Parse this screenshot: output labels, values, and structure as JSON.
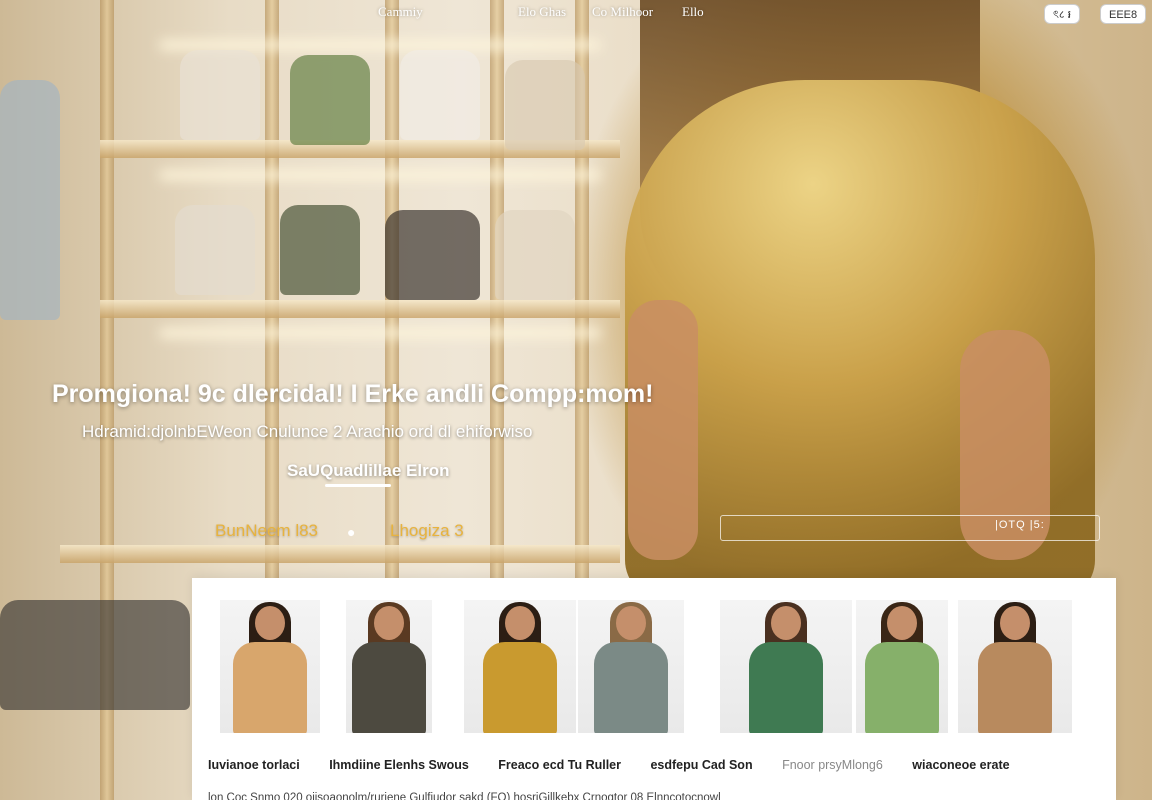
{
  "nav": {
    "links": [
      "Cammiy",
      "Elo Ghas",
      "Co Milhoor",
      "Ello"
    ],
    "button_1": "ৎ८ ៛",
    "button_2": "ЕЕЕ8"
  },
  "hero": {
    "title": "Promgiona! 9c dlercidal! I Erke andli Compp:mom!",
    "subtitle": "Hdramid:djolnbEWeon Cnulunce 2 Arachio ord dl ehiforwiso",
    "cta": "SaUQuadlillae Elron",
    "meta_left": "BunNeem l83",
    "meta_right": "Lhogiza 3",
    "waist_label": "|OTQ |5:"
  },
  "products": {
    "labels": [
      "Iuvianoe torlaci",
      "Ihmdiine Elenhs Swous",
      "Freaco ecd Tu Ruller",
      "esdfepu Cad Son",
      "Fnoor prsyMlong6",
      "wiaconeoe erate"
    ],
    "description": "lon Coc Snmo 020 oiisoaonolm/ruriene Gulfiudor sakd (FQ) hosriGillkebx Crnogtor 08 Elnncotocnowl"
  },
  "colors": {
    "accent_gold": "#e8b33e",
    "panel_bg": "#ffffff",
    "text_dark": "#222222"
  }
}
